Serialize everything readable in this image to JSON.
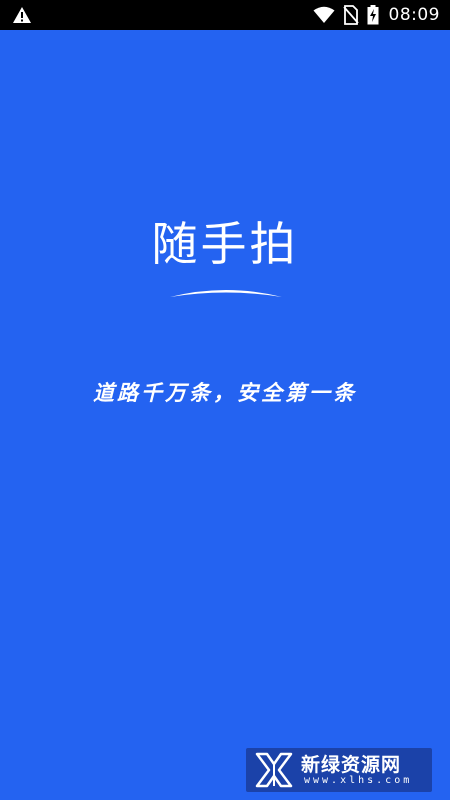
{
  "status_bar": {
    "time": "08:09",
    "icons": [
      "warning-icon",
      "wifi-icon",
      "no-sim-icon",
      "battery-charging-icon"
    ]
  },
  "splash": {
    "title": "随手拍",
    "slogan": "道路千万条，安全第一条"
  },
  "watermark": {
    "name": "新绿资源网",
    "url": "www.xlhs.com"
  },
  "colors": {
    "background": "#2463F1",
    "status_bar": "#000000",
    "text": "#FFFFFF"
  }
}
